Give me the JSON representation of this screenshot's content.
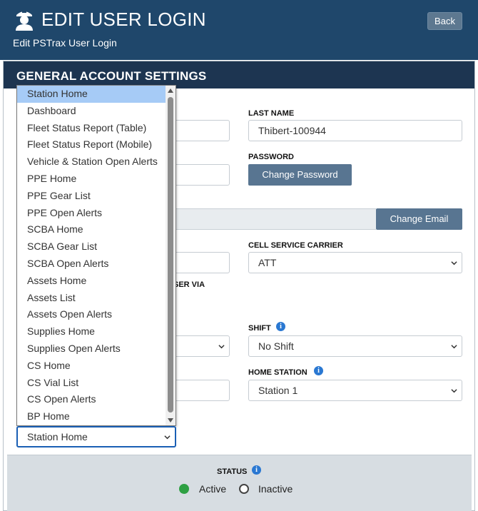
{
  "header": {
    "title": "EDIT USER LOGIN",
    "subtitle": "Edit PSTrax User Login",
    "back_label": "Back"
  },
  "section_title": "GENERAL ACCOUNT SETTINGS",
  "fields": {
    "last_name_label": "LAST NAME",
    "last_name_value": "Thibert-100944",
    "password_label": "PASSWORD",
    "change_password_label": "Change Password",
    "change_email_label": "Change Email",
    "cell_carrier_label": "CELL SERVICE CARRIER",
    "cell_carrier_value": "ATT",
    "partial_label": "SER VIA",
    "shift_label": "SHIFT",
    "shift_value": "No Shift",
    "home_station_label": "HOME STATION",
    "home_station_value": "Station 1",
    "landing_value": "Station Home"
  },
  "dropdown": {
    "selected": "Station Home",
    "options": [
      "Station Home",
      "Dashboard",
      "Fleet Status Report (Table)",
      "Fleet Status Report (Mobile)",
      "Vehicle & Station Open Alerts",
      "PPE Home",
      "PPE Gear List",
      "PPE Open Alerts",
      "SCBA Home",
      "SCBA Gear List",
      "SCBA Open Alerts",
      "Assets Home",
      "Assets List",
      "Assets Open Alerts",
      "Supplies Home",
      "Supplies Open Alerts",
      "CS Home",
      "CS Vial List",
      "CS Open Alerts",
      "BP Home"
    ]
  },
  "status": {
    "label": "STATUS",
    "active_label": "Active",
    "inactive_label": "Inactive",
    "selected": "Active"
  },
  "icons": {
    "info": "info-icon",
    "logo": "firefighter-logo-icon",
    "chevron": "chevron-down-icon"
  },
  "colors": {
    "header_bg": "#1f476b",
    "section_bg": "#1d3551",
    "button_bg": "#587591",
    "selected_option_bg": "#a6cbf6",
    "active_radio": "#2ea043",
    "info": "#2a78d2"
  }
}
